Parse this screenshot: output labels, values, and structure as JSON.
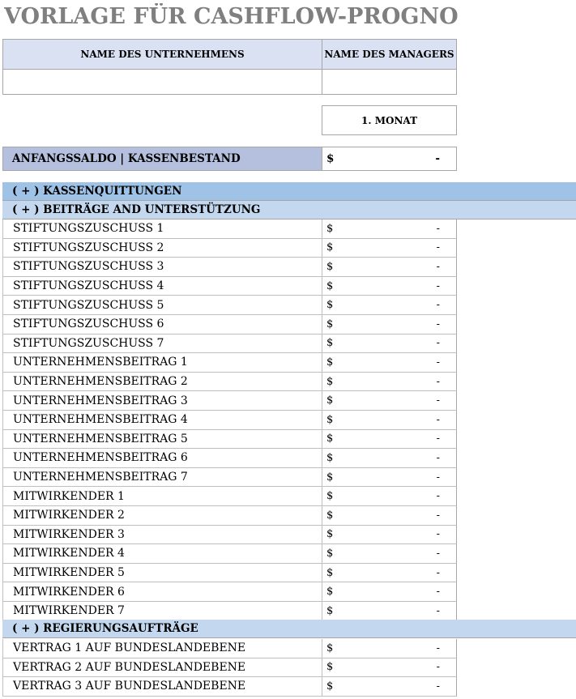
{
  "title": "VORLAGE FÜR CASHFLOW-PROGNOSE",
  "header": {
    "company_label": "NAME DES UNTERNEHMENS",
    "manager_label": "NAME DES MANAGERS",
    "company_value": "",
    "manager_value": ""
  },
  "month_label": "1. MONAT",
  "opening_balance": {
    "label": "ANFANGSSALDO | KASSENBESTAND",
    "currency": "$",
    "value": "-"
  },
  "sections": {
    "receipts": "( + ) KASSENQUITTUNGEN",
    "contributions": "( + ) BEITRÄGE AND UNTERSTÜTZUNG",
    "government": "( + ) REGIERUNGSAUFTRÄGE"
  },
  "contribution_rows": [
    {
      "label": "STIFTUNGSZUSCHUSS 1",
      "currency": "$",
      "value": "-"
    },
    {
      "label": "STIFTUNGSZUSCHUSS 2",
      "currency": "$",
      "value": "-"
    },
    {
      "label": "STIFTUNGSZUSCHUSS 3",
      "currency": "$",
      "value": "-"
    },
    {
      "label": "STIFTUNGSZUSCHUSS 4",
      "currency": "$",
      "value": "-"
    },
    {
      "label": "STIFTUNGSZUSCHUSS 5",
      "currency": "$",
      "value": "-"
    },
    {
      "label": "STIFTUNGSZUSCHUSS 6",
      "currency": "$",
      "value": "-"
    },
    {
      "label": "STIFTUNGSZUSCHUSS 7",
      "currency": "$",
      "value": "-"
    },
    {
      "label": "UNTERNEHMENSBEITRAG 1",
      "currency": "$",
      "value": "-"
    },
    {
      "label": "UNTERNEHMENSBEITRAG 2",
      "currency": "$",
      "value": "-"
    },
    {
      "label": "UNTERNEHMENSBEITRAG 3",
      "currency": "$",
      "value": "-"
    },
    {
      "label": "UNTERNEHMENSBEITRAG 4",
      "currency": "$",
      "value": "-"
    },
    {
      "label": "UNTERNEHMENSBEITRAG 5",
      "currency": "$",
      "value": "-"
    },
    {
      "label": "UNTERNEHMENSBEITRAG 6",
      "currency": "$",
      "value": "-"
    },
    {
      "label": "UNTERNEHMENSBEITRAG 7",
      "currency": "$",
      "value": "-"
    },
    {
      "label": "MITWIRKENDER 1",
      "currency": "$",
      "value": "-"
    },
    {
      "label": "MITWIRKENDER 2",
      "currency": "$",
      "value": "-"
    },
    {
      "label": "MITWIRKENDER 3",
      "currency": "$",
      "value": "-"
    },
    {
      "label": "MITWIRKENDER 4",
      "currency": "$",
      "value": "-"
    },
    {
      "label": "MITWIRKENDER 5",
      "currency": "$",
      "value": "-"
    },
    {
      "label": "MITWIRKENDER 6",
      "currency": "$",
      "value": "-"
    },
    {
      "label": "MITWIRKENDER 7",
      "currency": "$",
      "value": "-"
    }
  ],
  "government_rows": [
    {
      "label": "VERTRAG 1 AUF BUNDESLANDEBENE",
      "currency": "$",
      "value": "-"
    },
    {
      "label": "VERTRAG 2 AUF BUNDESLANDEBENE",
      "currency": "$",
      "value": "-"
    },
    {
      "label": "VERTRAG 3 AUF BUNDESLANDEBENE",
      "currency": "$",
      "value": "-"
    }
  ]
}
